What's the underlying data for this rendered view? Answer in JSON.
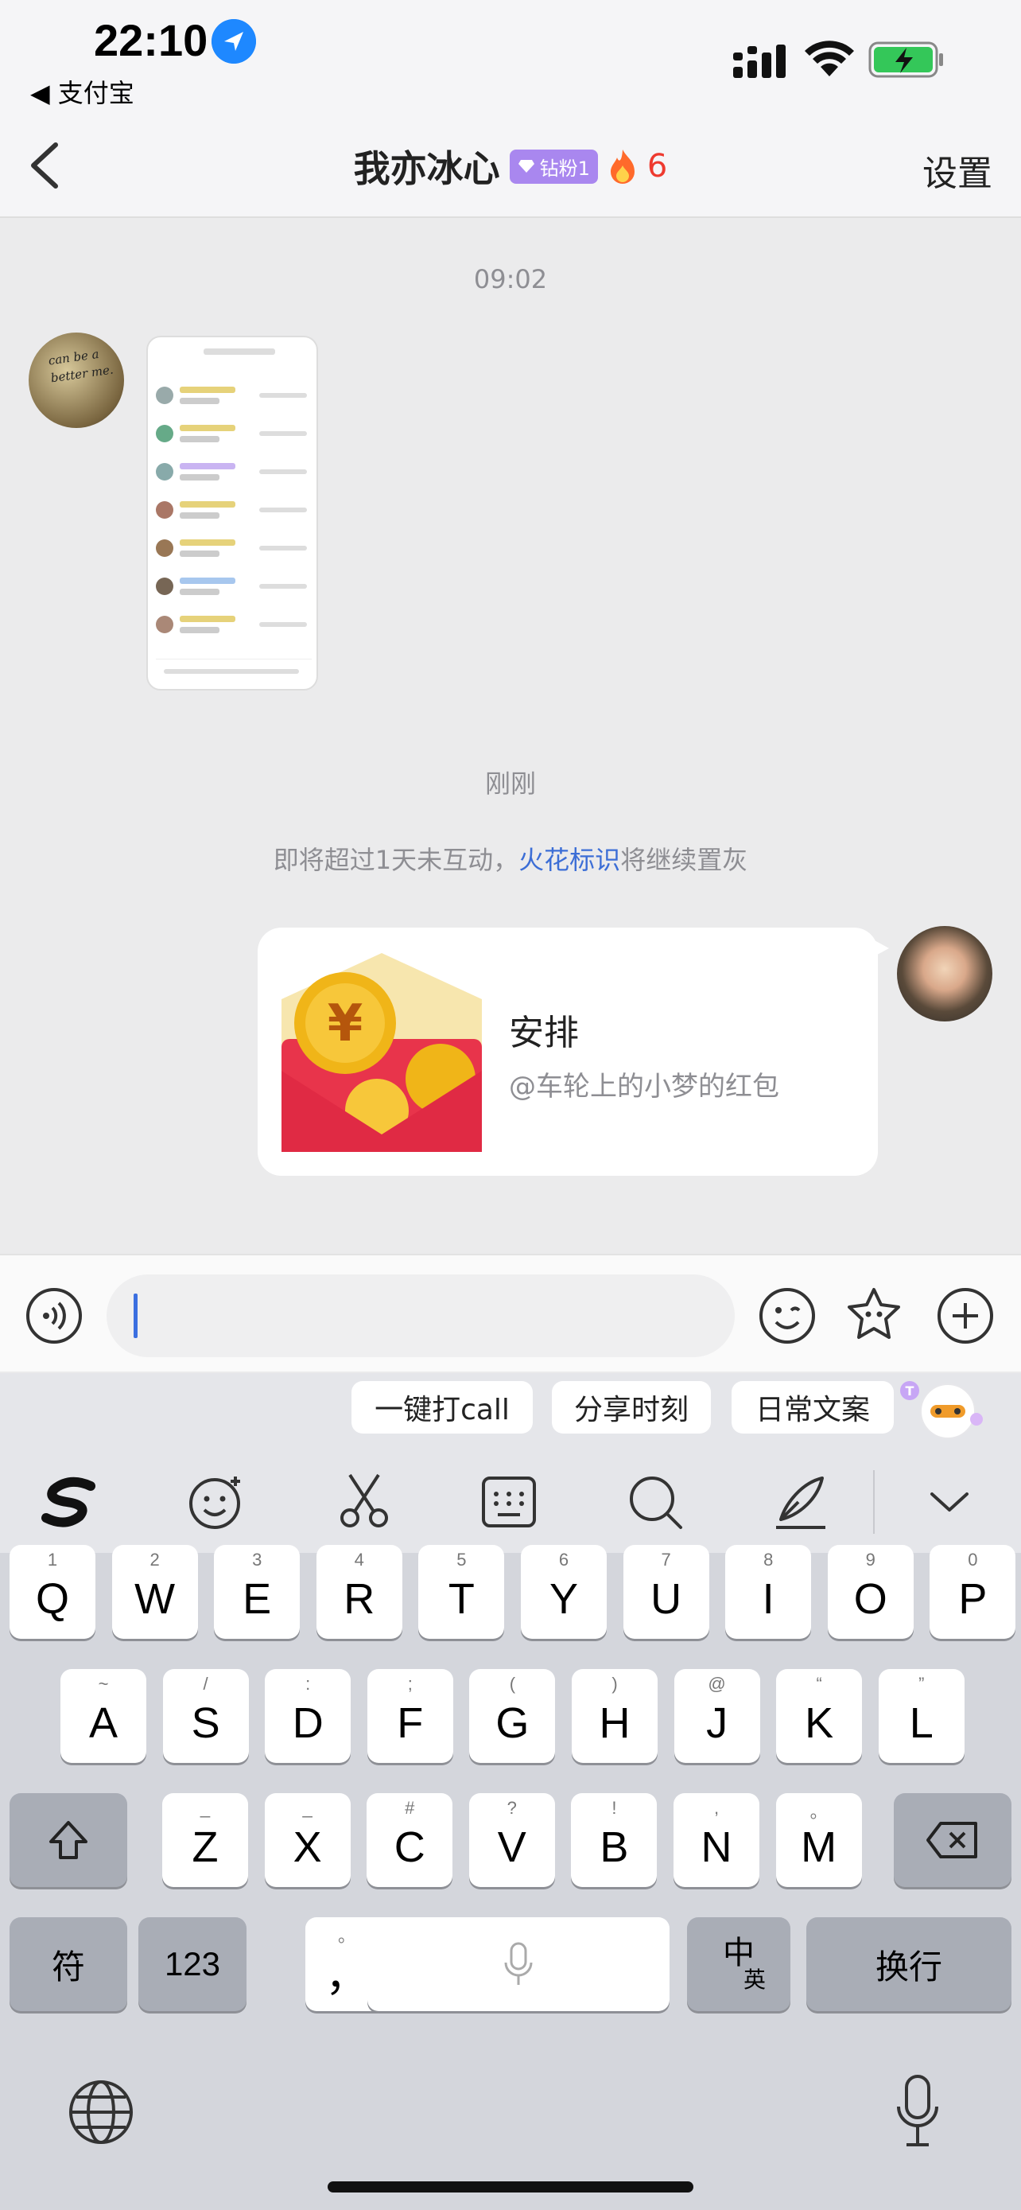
{
  "status_bar": {
    "time": "22:10",
    "back_app": "◀ 支付宝"
  },
  "nav": {
    "title": "我亦冰心",
    "fan_badge": "钻粉1",
    "fire_count": "6",
    "settings": "设置"
  },
  "chat": {
    "timestamp_1": "09:02",
    "timestamp_2": "刚刚",
    "notice_prefix": "即将超过1天未互动，",
    "notice_link": "火花标识",
    "notice_suffix": "将继续置灰",
    "avatar_left_text": "can be a better me.",
    "red_packet": {
      "title": "安排",
      "subtitle": "@车轮上的小梦的红包"
    }
  },
  "input": {
    "value": "",
    "placeholder": ""
  },
  "keyboard": {
    "suggestions": [
      "一键打call",
      "分享时刻",
      "日常文案"
    ],
    "row1": [
      {
        "hint": "1",
        "key": "Q"
      },
      {
        "hint": "2",
        "key": "W"
      },
      {
        "hint": "3",
        "key": "E"
      },
      {
        "hint": "4",
        "key": "R"
      },
      {
        "hint": "5",
        "key": "T"
      },
      {
        "hint": "6",
        "key": "Y"
      },
      {
        "hint": "7",
        "key": "U"
      },
      {
        "hint": "8",
        "key": "I"
      },
      {
        "hint": "9",
        "key": "O"
      },
      {
        "hint": "0",
        "key": "P"
      }
    ],
    "row2": [
      {
        "hint": "~",
        "key": "A"
      },
      {
        "hint": "/",
        "key": "S"
      },
      {
        "hint": ":",
        "key": "D"
      },
      {
        "hint": ";",
        "key": "F"
      },
      {
        "hint": "(",
        "key": "G"
      },
      {
        "hint": ")",
        "key": "H"
      },
      {
        "hint": "@",
        "key": "J"
      },
      {
        "hint": "“",
        "key": "K"
      },
      {
        "hint": "”",
        "key": "L"
      }
    ],
    "row3": [
      {
        "hint": "_",
        "key": "Z"
      },
      {
        "hint": "_",
        "key": "X"
      },
      {
        "hint": "#",
        "key": "C"
      },
      {
        "hint": "?",
        "key": "V"
      },
      {
        "hint": "!",
        "key": "B"
      },
      {
        "hint": ",",
        "key": "N"
      },
      {
        "hint": "。",
        "key": "M"
      }
    ],
    "symbols_key": "符",
    "numbers_key": "123",
    "comma_key": "，",
    "comma_hint": "。",
    "lang_key_main": "中",
    "lang_key_sub": "英",
    "return_key": "换行"
  }
}
